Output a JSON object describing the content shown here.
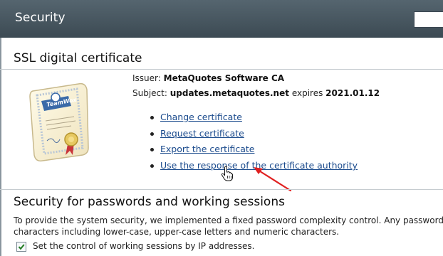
{
  "header": {
    "title": "Security"
  },
  "ssl": {
    "title": "SSL digital certificate",
    "issuer_label": "Issuer:",
    "issuer_value": "MetaQuotes Software CA",
    "subject_label": "Subject:",
    "subject_value": "updates.metaquotes.net",
    "expires_label": "expires",
    "expires_value": "2021.01.12",
    "certificate_image_text": "TeamWox",
    "links": [
      "Change certificate",
      "Request certificate",
      "Export the certificate",
      "Use the response of the certificate authority"
    ]
  },
  "security_sessions": {
    "title": "Security for passwords and working sessions",
    "description_line1": "To provide the system security, we implemented a fixed password complexity control. Any password must con",
    "description_line2": "characters including lower-case, upper-case letters and numeric characters.",
    "checkbox_label": "Set the control of working sessions by IP addresses.",
    "checkbox_checked": true
  },
  "colors": {
    "header_bg": "#46555e",
    "link": "#1a4a8c",
    "annotation_arrow": "#e02020"
  }
}
